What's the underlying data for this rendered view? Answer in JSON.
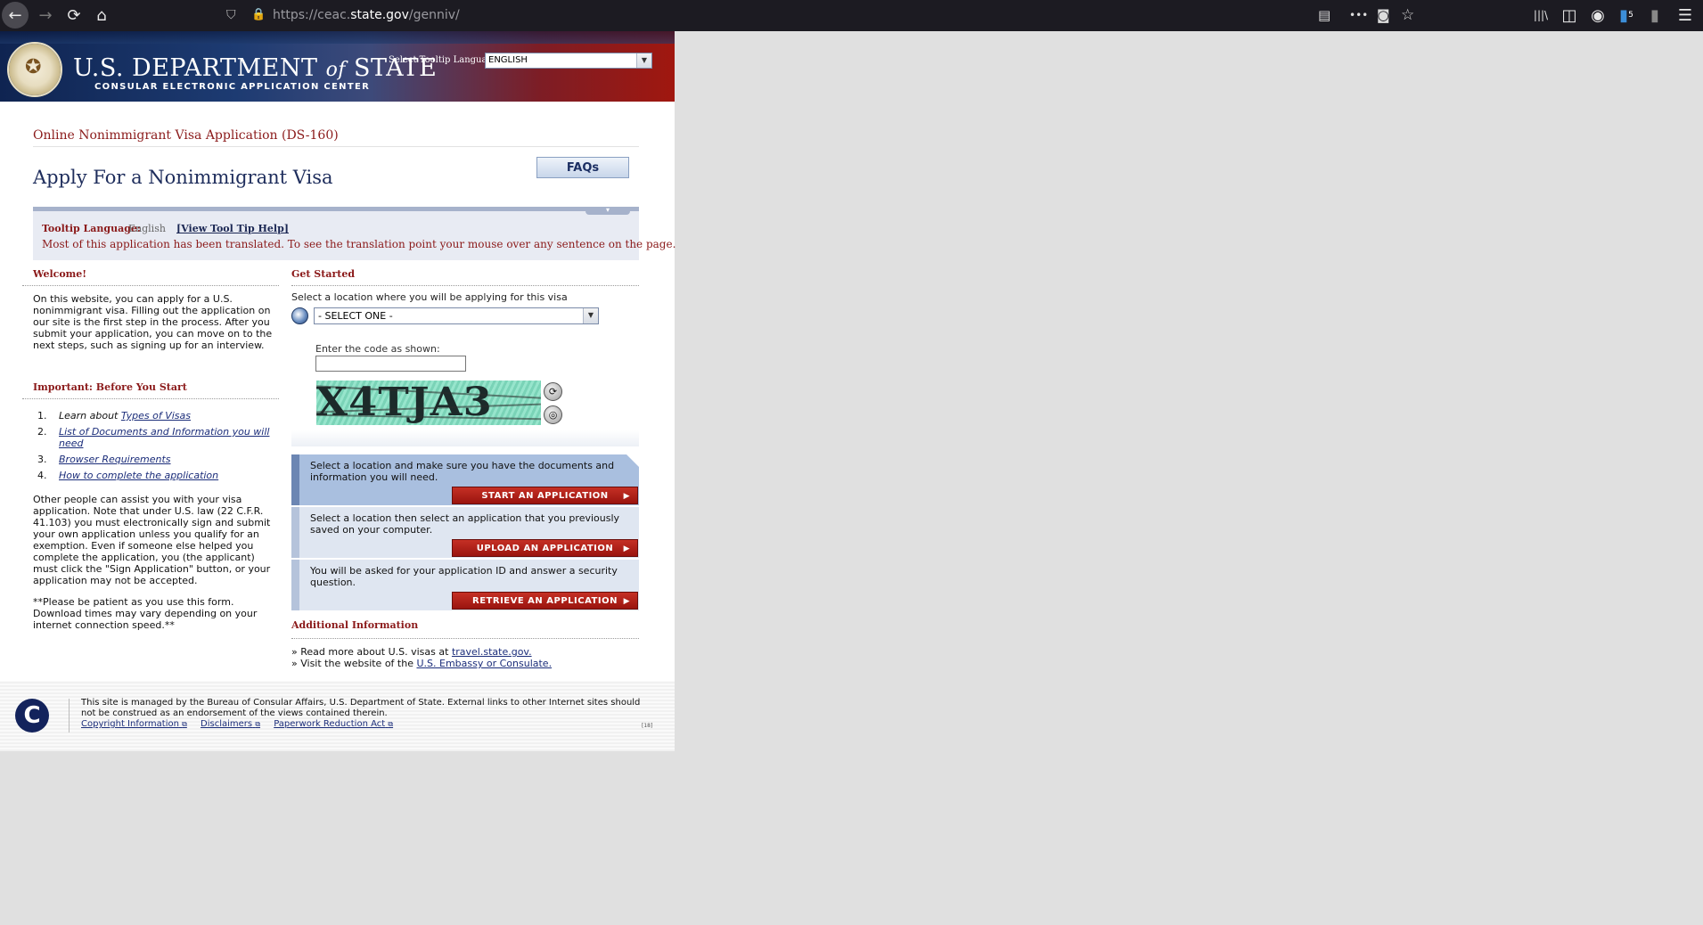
{
  "browser": {
    "url_prefix": "https://ceac.",
    "url_domain": "state.gov",
    "url_path": "/genniv/",
    "icons": {
      "back": "←",
      "forward": "→",
      "reload": "⟳",
      "home": "⌂",
      "shield": "⛉",
      "lock": "🔒",
      "reader": "▤",
      "more": "•••",
      "pocket": "◙",
      "star": "☆",
      "library": "|||\\",
      "sidebar": "◫",
      "account": "◉",
      "extension": "▮",
      "menu": "☰"
    },
    "extension_badge": "5"
  },
  "header": {
    "dept_part1": "U.S. DEPARTMENT",
    "dept_of": "of",
    "dept_part2": "STATE",
    "subtitle": "CONSULAR ELECTRONIC APPLICATION CENTER",
    "tooltip_lang_label": "Select Tooltip Language",
    "tooltip_lang_value": "ENGLISH"
  },
  "main": {
    "app_subtitle": "Online Nonimmigrant Visa Application (DS-160)",
    "page_title": "Apply For a Nonimmigrant Visa",
    "faqs_label": "FAQs"
  },
  "tooltip_panel": {
    "label": "Tooltip Language:",
    "value": "English",
    "help_link": "[View Tool Tip Help]",
    "note": "Most of this application has been translated. To see the translation point your mouse over any sentence on the page."
  },
  "welcome": {
    "heading": "Welcome!",
    "text": "On this website, you can apply for a U.S. nonimmigrant visa. Filling out the application on our site is the first step in the process. After you submit your application, you can move on to the next steps, such as signing up for an interview.",
    "important_heading": "Important: Before You Start",
    "steps": [
      {
        "num": "1.",
        "prefix": "Learn about ",
        "link": "Types of Visas"
      },
      {
        "num": "2.",
        "prefix": "",
        "link": "List of Documents and Information you will need"
      },
      {
        "num": "3.",
        "prefix": "",
        "link": "Browser Requirements"
      },
      {
        "num": "4.",
        "prefix": "",
        "link": "How to complete the application"
      }
    ],
    "assist_text": "Other people can assist you with your visa application. Note that under U.S. law (22 C.F.R. 41.103) you must electronically sign and submit your own application unless you qualify for an exemption. Even if someone else helped you complete the application, you (the applicant) must click the \"Sign Application\" button, or your application may not be accepted.",
    "patience_text": "**Please be patient as you use this form. Download times may vary depending on your internet connection speed.**"
  },
  "get_started": {
    "heading": "Get Started",
    "location_label": "Select a location where you will be applying for this visa",
    "location_value": "- SELECT ONE -",
    "captcha_label": "Enter the code as shown:",
    "captcha_value": "",
    "captcha_code": "X4TJA3",
    "refresh_icon": "⟳",
    "audio_icon": "◎"
  },
  "actions": [
    {
      "desc": "Select a location and make sure you have the documents and information you will need.",
      "button": "START AN APPLICATION"
    },
    {
      "desc": "Select a location then select an application that you previously saved on your computer.",
      "button": "UPLOAD AN APPLICATION"
    },
    {
      "desc": "You will be asked for your application ID and answer a security question.",
      "button": "RETRIEVE AN APPLICATION"
    }
  ],
  "additional": {
    "heading": "Additional Information",
    "line1_prefix": "» Read more about U.S. visas at ",
    "line1_link": "travel.state.gov.",
    "line2_prefix": "» Visit the website of the ",
    "line2_link": "U.S. Embassy or Consulate."
  },
  "footer": {
    "logo": "C",
    "text": "This site is managed by the Bureau of Consular Affairs, U.S. Department of State. External links to other Internet sites should not be construed as an endorsement of the views contained therein.",
    "links": [
      "Copyright Information",
      "Disclaimers",
      "Paperwork Reduction Act"
    ],
    "ext_icon": "⧉",
    "tag": "[18]"
  }
}
